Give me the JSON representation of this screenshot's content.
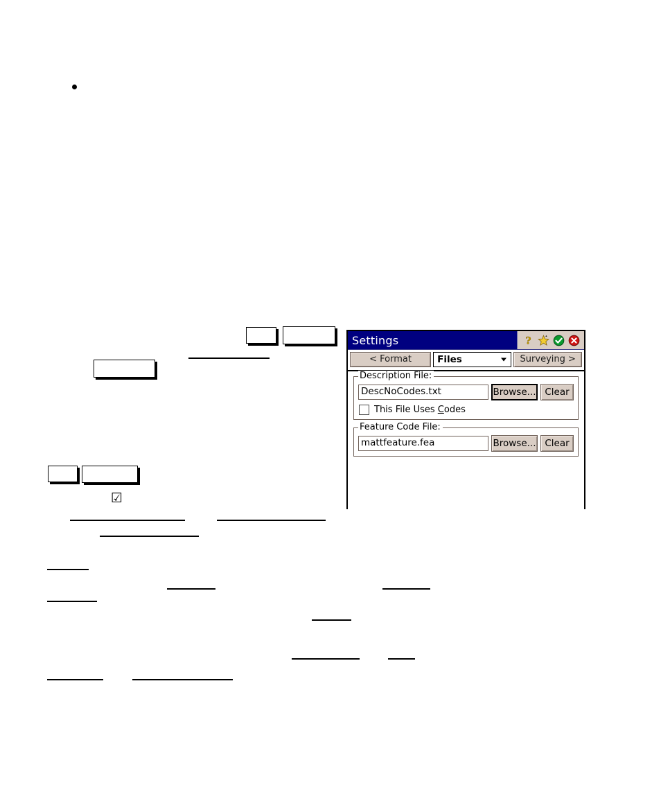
{
  "document": {
    "bullet_marker": "•",
    "checked_checkbox_glyph": "☑"
  },
  "dialog": {
    "title": "Settings",
    "title_icons": [
      {
        "name": "help-icon",
        "label": "?"
      },
      {
        "name": "favorites-star-icon",
        "label": "Favorites"
      },
      {
        "name": "ok-check-icon",
        "label": "OK"
      },
      {
        "name": "close-x-icon",
        "label": "Close"
      }
    ],
    "toolbar": {
      "prev_label": "< Format",
      "page_selector": {
        "selected": "Files",
        "options": [
          "Files"
        ]
      },
      "next_label": "Surveying >"
    },
    "groups": [
      {
        "title": "Description File:",
        "field_value": "DescNoCodes.txt",
        "browse_label": "Browse...",
        "clear_label": "Clear",
        "browse_focused": true,
        "checkbox": {
          "checked": false,
          "label_before": "This File Uses ",
          "label_accel": "C",
          "label_after": "odes"
        }
      },
      {
        "title": "Feature Code File:",
        "field_value": "mattfeature.fea",
        "browse_label": "Browse...",
        "clear_label": "Clear",
        "browse_focused": false
      }
    ],
    "colors": {
      "titlebar": "#000080",
      "titlebar_text": "#ffffff",
      "button_face": "#d9cdc4",
      "window_face": "#ffffff",
      "border": "#000000",
      "ok_green": "#0a9a2e",
      "close_red": "#d01414",
      "star_yellow": "#f2cc33"
    }
  }
}
